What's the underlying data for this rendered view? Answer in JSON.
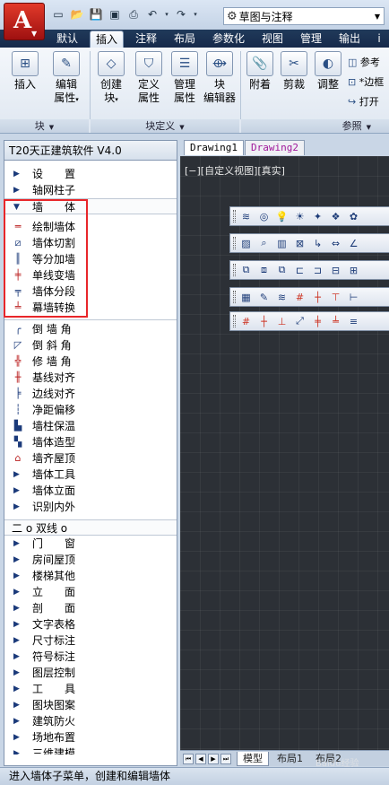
{
  "title_bar": {
    "workspace": "草图与注释"
  },
  "ribbon_tabs": [
    "默认",
    "插入",
    "注释",
    "布局",
    "参数化",
    "视图",
    "管理",
    "输出",
    "i"
  ],
  "ribbon": {
    "buttons": [
      {
        "label": "插入",
        "icon": "insert-block-icon"
      },
      {
        "label1": "编辑",
        "label2": "属性",
        "icon": "edit-attribute-icon"
      },
      {
        "label1": "创建",
        "label2": "块",
        "icon": "create-block-icon"
      },
      {
        "label1": "定义",
        "label2": "属性",
        "icon": "define-attribute-icon"
      },
      {
        "label1": "管理",
        "label2": "属性",
        "icon": "manage-attribute-icon"
      },
      {
        "label1": "块",
        "label2": "编辑器",
        "icon": "block-editor-icon"
      },
      {
        "label": "附着",
        "icon": "attach-icon"
      },
      {
        "label": "剪裁",
        "icon": "clip-icon"
      },
      {
        "label": "调整",
        "icon": "adjust-icon"
      }
    ],
    "small_buttons": [
      "参考",
      "*边框",
      "打开"
    ],
    "groups": [
      "块",
      "块定义",
      "参照"
    ]
  },
  "drawing_tabs": [
    "Drawing1",
    "Drawing2"
  ],
  "viewport": {
    "label": "[−][自定义视图][真实]"
  },
  "layout_tabs": [
    "模型",
    "布局1",
    "布局2"
  ],
  "panel": {
    "title": "T20天正建筑软件 V4.0",
    "menu_top": [
      {
        "label": "设　　置",
        "type": "submenu"
      },
      {
        "label": "轴网柱子",
        "type": "submenu"
      },
      {
        "label": "墙　　体",
        "type": "open"
      }
    ],
    "wall_items": [
      {
        "label": "绘制墙体",
        "icon": "draw-wall-icon"
      },
      {
        "label": "墙体切割",
        "icon": "wall-cut-icon"
      },
      {
        "label": "等分加墙",
        "icon": "divide-wall-icon"
      },
      {
        "label": "单线变墙",
        "icon": "line-to-wall-icon"
      },
      {
        "label": "墙体分段",
        "icon": "wall-segment-icon"
      },
      {
        "label": "幕墙转换",
        "icon": "curtain-wall-icon"
      }
    ],
    "edit_items": [
      {
        "label": "倒 墙 角",
        "icon": "fillet-wall-icon"
      },
      {
        "label": "倒 斜 角",
        "icon": "chamfer-wall-icon"
      },
      {
        "label": "修 墙 角",
        "icon": "fix-corner-icon"
      },
      {
        "label": "基线对齐",
        "icon": "baseline-align-icon"
      },
      {
        "label": "边线对齐",
        "icon": "edge-align-icon"
      },
      {
        "label": "净距偏移",
        "icon": "offset-icon"
      },
      {
        "label": "墙柱保温",
        "icon": "insulation-icon"
      },
      {
        "label": "墙体造型",
        "icon": "wall-shape-icon"
      },
      {
        "label": "墙齐屋顶",
        "icon": "roof-align-icon"
      }
    ],
    "sub_items": [
      "墙体工具",
      "墙体立面",
      "识别内外"
    ],
    "double_line": "二 o 双线 o",
    "main_items": [
      "门　　窗",
      "房间屋顶",
      "楼梯其他",
      "立　　面",
      "剖　　面",
      "文字表格",
      "尺寸标注",
      "符号标注",
      "图层控制",
      "工　　具",
      "图块图案",
      "建筑防火",
      "场地布置",
      "三维建模"
    ]
  },
  "status": "进入墙体子菜单，创建和编辑墙体",
  "watermark": "Baidu经验"
}
